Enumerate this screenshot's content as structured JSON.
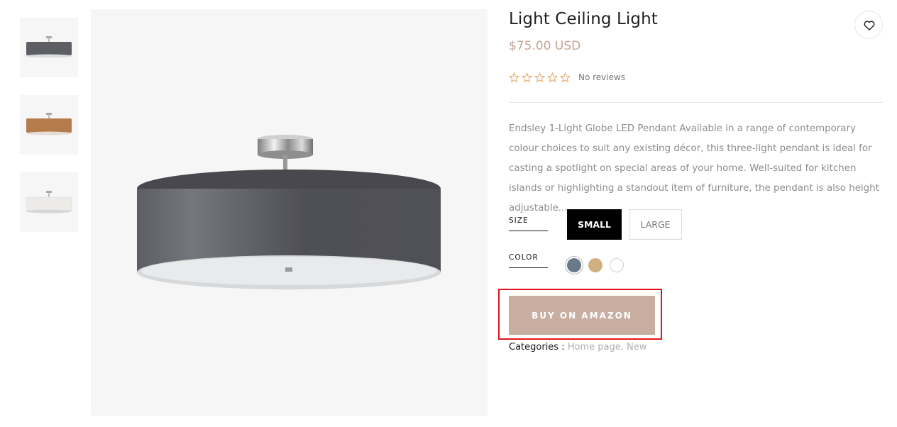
{
  "product": {
    "title": "Light Ceiling Light",
    "price": "$75.00 USD",
    "rating_stars": 0,
    "reviews_text": "No reviews",
    "description": "Endsley 1-Light Globe LED Pendant Available in a range of contemporary colour choices to suit any existing décor, this three-light pendant is ideal for casting a spotlight on special areas of your home. Well-suited for kitchen islands or highlighting a standout item of furniture, the pendant is also height adjustable..."
  },
  "thumbnails": [
    {
      "shade_color": "#5c5e63",
      "icon": "pendant-lamp-grey"
    },
    {
      "shade_color": "#b57c4b",
      "icon": "pendant-lamp-copper"
    },
    {
      "shade_color": "#ecebe8",
      "icon": "pendant-lamp-white"
    }
  ],
  "main_image": {
    "shade_color": "#55555b",
    "icon": "pendant-lamp-grey"
  },
  "options": {
    "size_label": "SIZE",
    "sizes": [
      {
        "label": "SMALL",
        "selected": true
      },
      {
        "label": "LARGE",
        "selected": false
      }
    ],
    "color_label": "COLOR",
    "colors": [
      {
        "hex": "#6b7a8b",
        "selected": true
      },
      {
        "hex": "#d0b07e",
        "selected": false
      },
      {
        "hex": "#ffffff",
        "selected": false
      }
    ]
  },
  "buy_button": {
    "label": "BUY ON AMAZON",
    "color": "#c8aea1",
    "highlight_color": "#e5131b"
  },
  "categories": {
    "label": "Categories :",
    "links": [
      "Home page",
      "New"
    ]
  },
  "icons": {
    "wishlist": "heart-icon",
    "star": "star-outline-icon"
  },
  "colors": {
    "accent_price": "#c4a595",
    "star": "#e6a35f"
  }
}
